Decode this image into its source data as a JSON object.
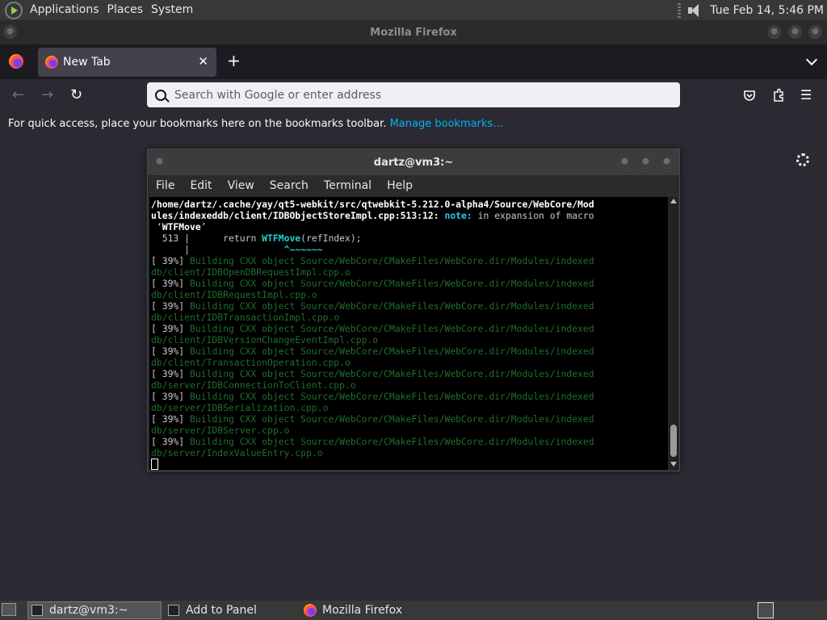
{
  "top_panel": {
    "menus": [
      "Applications",
      "Places",
      "System"
    ],
    "clock": "Tue Feb 14,  5:46 PM"
  },
  "firefox": {
    "window_title": "Mozilla Firefox",
    "tab_title": "New Tab",
    "new_tab_symbol": "+",
    "close_symbol": "✕",
    "address_placeholder": "Search with Google or enter address",
    "bookmarks_text": "For quick access, place your bookmarks here on the bookmarks toolbar.",
    "manage_bookmarks": "Manage bookmarks…",
    "icons": {
      "back": "←",
      "forward": "→",
      "reload": "↻",
      "pocket": "pocket-icon",
      "extensions": "extensions-icon",
      "menu": "☰"
    }
  },
  "terminal": {
    "title": "dartz@vm3:~",
    "menu": [
      "File",
      "Edit",
      "View",
      "Search",
      "Terminal",
      "Help"
    ],
    "lines": [
      {
        "parts": [
          {
            "t": "/home/dartz/.cache/yay/qt5-webkit/src/qtwebkit-5.212.0-alpha4/Source/WebCore/Mod",
            "c": "c-white"
          }
        ]
      },
      {
        "parts": [
          {
            "t": "ules/indexeddb/client/IDBObjectStoreImpl.cpp:513:12: ",
            "c": "c-white"
          },
          {
            "t": "note:",
            "c": "c-note"
          },
          {
            "t": " in expansion of macro",
            "c": "c-grey"
          }
        ]
      },
      {
        "parts": [
          {
            "t": " ‘",
            "c": "c-grey"
          },
          {
            "t": "WTFMove",
            "c": "c-white"
          },
          {
            "t": "’",
            "c": "c-grey"
          }
        ]
      },
      {
        "parts": [
          {
            "t": "  513 |      return ",
            "c": "c-grey"
          },
          {
            "t": "WTFMove",
            "c": "c-cyan"
          },
          {
            "t": "(refIndex);",
            "c": "c-grey"
          }
        ]
      },
      {
        "parts": [
          {
            "t": "      |                 ",
            "c": "c-grey"
          },
          {
            "t": "^~~~~~~",
            "c": "c-cyan"
          }
        ]
      },
      {
        "parts": [
          {
            "t": "[ 39%] ",
            "c": "c-grey"
          },
          {
            "t": "Building CXX object Source/WebCore/CMakeFiles/WebCore.dir/Modules/indexed",
            "c": "c-green"
          }
        ]
      },
      {
        "parts": [
          {
            "t": "db/client/IDBOpenDBRequestImpl.cpp.o",
            "c": "c-green"
          }
        ]
      },
      {
        "parts": [
          {
            "t": "[ 39%] ",
            "c": "c-grey"
          },
          {
            "t": "Building CXX object Source/WebCore/CMakeFiles/WebCore.dir/Modules/indexed",
            "c": "c-green"
          }
        ]
      },
      {
        "parts": [
          {
            "t": "db/client/IDBRequestImpl.cpp.o",
            "c": "c-green"
          }
        ]
      },
      {
        "parts": [
          {
            "t": "[ 39%] ",
            "c": "c-grey"
          },
          {
            "t": "Building CXX object Source/WebCore/CMakeFiles/WebCore.dir/Modules/indexed",
            "c": "c-green"
          }
        ]
      },
      {
        "parts": [
          {
            "t": "db/client/IDBTransactionImpl.cpp.o",
            "c": "c-green"
          }
        ]
      },
      {
        "parts": [
          {
            "t": "[ 39%] ",
            "c": "c-grey"
          },
          {
            "t": "Building CXX object Source/WebCore/CMakeFiles/WebCore.dir/Modules/indexed",
            "c": "c-green"
          }
        ]
      },
      {
        "parts": [
          {
            "t": "db/client/IDBVersionChangeEventImpl.cpp.o",
            "c": "c-green"
          }
        ]
      },
      {
        "parts": [
          {
            "t": "[ 39%] ",
            "c": "c-grey"
          },
          {
            "t": "Building CXX object Source/WebCore/CMakeFiles/WebCore.dir/Modules/indexed",
            "c": "c-green"
          }
        ]
      },
      {
        "parts": [
          {
            "t": "db/client/TransactionOperation.cpp.o",
            "c": "c-green"
          }
        ]
      },
      {
        "parts": [
          {
            "t": "[ 39%] ",
            "c": "c-grey"
          },
          {
            "t": "Building CXX object Source/WebCore/CMakeFiles/WebCore.dir/Modules/indexed",
            "c": "c-green"
          }
        ]
      },
      {
        "parts": [
          {
            "t": "db/server/IDBConnectionToClient.cpp.o",
            "c": "c-green"
          }
        ]
      },
      {
        "parts": [
          {
            "t": "[ 39%] ",
            "c": "c-grey"
          },
          {
            "t": "Building CXX object Source/WebCore/CMakeFiles/WebCore.dir/Modules/indexed",
            "c": "c-green"
          }
        ]
      },
      {
        "parts": [
          {
            "t": "db/server/IDBSerialization.cpp.o",
            "c": "c-green"
          }
        ]
      },
      {
        "parts": [
          {
            "t": "[ 39%] ",
            "c": "c-grey"
          },
          {
            "t": "Building CXX object Source/WebCore/CMakeFiles/WebCore.dir/Modules/indexed",
            "c": "c-green"
          }
        ]
      },
      {
        "parts": [
          {
            "t": "db/server/IDBServer.cpp.o",
            "c": "c-green"
          }
        ]
      },
      {
        "parts": [
          {
            "t": "[ 39%] ",
            "c": "c-grey"
          },
          {
            "t": "Building CXX object Source/WebCore/CMakeFiles/WebCore.dir/Modules/indexed",
            "c": "c-green"
          }
        ]
      },
      {
        "parts": [
          {
            "t": "db/server/IndexValueEntry.cpp.o",
            "c": "c-green"
          }
        ]
      }
    ]
  },
  "bottom_panel": {
    "tasks": [
      "dartz@vm3:~",
      "Add to Panel",
      "Mozilla Firefox"
    ]
  },
  "colors": {
    "firefox_bg": "#2b2a33",
    "link": "#00b3f4",
    "terminal_green": "#1f6f2a",
    "terminal_note": "#2ec8f0"
  }
}
